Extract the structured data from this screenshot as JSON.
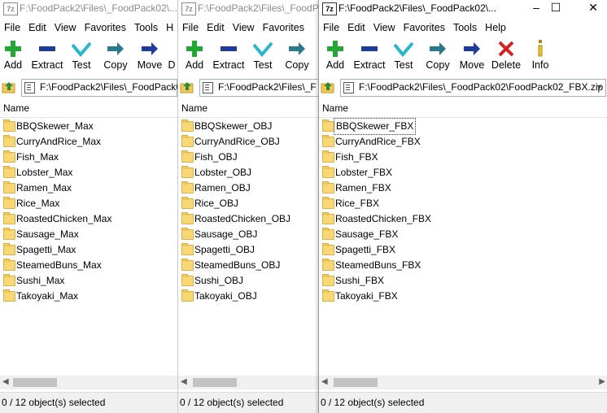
{
  "windows": [
    {
      "title": "F:\\FoodPack2\\Files\\_FoodPack02\\...",
      "active": false,
      "menus": [
        "File",
        "Edit",
        "View",
        "Favorites",
        "Tools",
        "H"
      ],
      "toolbar": [
        "Add",
        "Extract",
        "Test",
        "Copy",
        "Move",
        "D"
      ],
      "address": "F:\\FoodPack2\\Files\\_FoodPack0",
      "column": "Name",
      "items": [
        "BBQSkewer_Max",
        "CurryAndRice_Max",
        "Fish_Max",
        "Lobster_Max",
        "Ramen_Max",
        "Rice_Max",
        "RoastedChicken_Max",
        "Sausage_Max",
        "Spagetti_Max",
        "SteamedBuns_Max",
        "Sushi_Max",
        "Takoyaki_Max"
      ],
      "status": "0 / 12 object(s) selected"
    },
    {
      "title": "F:\\FoodPack2\\Files\\_FoodPa",
      "active": false,
      "menus": [
        "File",
        "Edit",
        "View",
        "Favorites"
      ],
      "toolbar": [
        "Add",
        "Extract",
        "Test",
        "Copy"
      ],
      "address": "F:\\FoodPack2\\Files\\_F",
      "column": "Name",
      "items": [
        "BBQSkewer_OBJ",
        "CurryAndRice_OBJ",
        "Fish_OBJ",
        "Lobster_OBJ",
        "Ramen_OBJ",
        "Rice_OBJ",
        "RoastedChicken_OBJ",
        "Sausage_OBJ",
        "Spagetti_OBJ",
        "SteamedBuns_OBJ",
        "Sushi_OBJ",
        "Takoyaki_OBJ"
      ],
      "status": "0 / 12 object(s) selected"
    },
    {
      "title": "F:\\FoodPack2\\Files\\_FoodPack02\\...",
      "active": true,
      "caption_buttons": [
        "–",
        "☐",
        "✕"
      ],
      "menus": [
        "File",
        "Edit",
        "View",
        "Favorites",
        "Tools",
        "Help"
      ],
      "toolbar": [
        "Add",
        "Extract",
        "Test",
        "Copy",
        "Move",
        "Delete",
        "Info"
      ],
      "address": "F:\\FoodPack2\\Files\\_FoodPack02\\FoodPack02_FBX.zip",
      "column": "Name",
      "items": [
        "BBQSkewer_FBX",
        "CurryAndRice_FBX",
        "Fish_FBX",
        "Lobster_FBX",
        "Ramen_FBX",
        "Rice_FBX",
        "RoastedChicken_FBX",
        "Sausage_FBX",
        "Spagetti_FBX",
        "SteamedBuns_FBX",
        "Sushi_FBX",
        "Takoyaki_FBX"
      ],
      "status": "0 / 12 object(s) selected"
    }
  ],
  "app_icon_label": "7z",
  "toolbar_icons": {
    "Add": "plus-icon",
    "Extract": "minus-icon",
    "Test": "check-icon",
    "Copy": "copy-arrow-icon",
    "Move": "move-arrow-icon",
    "Delete": "x-icon",
    "Info": "info-icon",
    "D": "delete-partial-icon"
  },
  "colors": {
    "add": "#22a832",
    "extract": "#1f3c9c",
    "test": "#28b6c8",
    "copy": "#2a7a8c",
    "move": "#1f3c9c",
    "delete": "#d42020"
  }
}
